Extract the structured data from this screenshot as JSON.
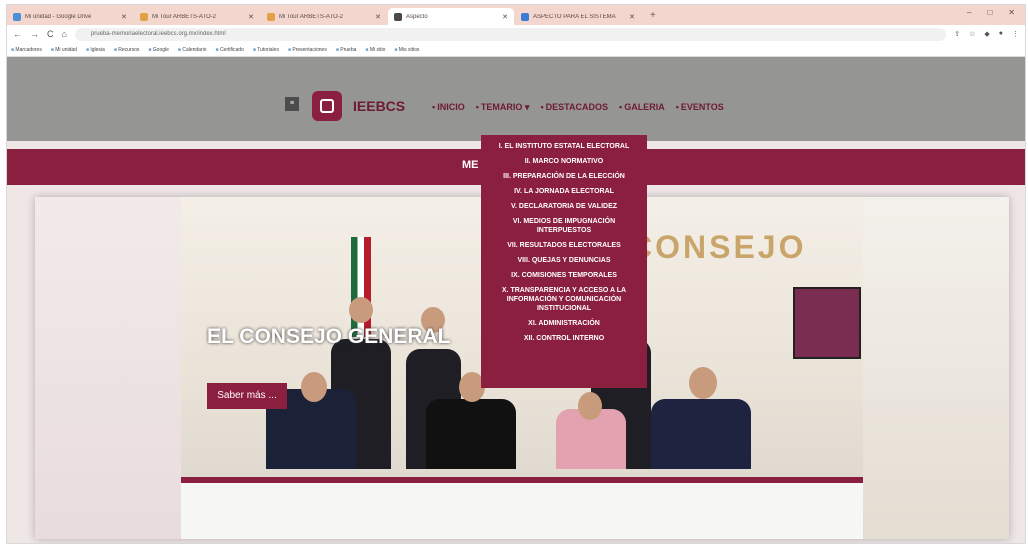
{
  "browser": {
    "tabs": [
      {
        "label": "Mi unidad - Google Drive",
        "color": "#4a90d9"
      },
      {
        "label": "Mi Tour ARBETS-ATO-2",
        "color": "#e1a144"
      },
      {
        "label": "Mi Tour ARBETS-ATO-2",
        "color": "#e1a144"
      },
      {
        "label": "Aspecto",
        "color": "#4a4a4a",
        "active": true
      },
      {
        "label": "ASPECTO PARA EL SISTEMA",
        "color": "#3d7bd6"
      }
    ],
    "new_tab": "+",
    "window_controls": [
      "–",
      "□",
      "✕"
    ],
    "url": "prueba-memoriaelectoral.ieebcs.org.mx/index.html",
    "bookmarks": [
      "Marcadores",
      "Mi unidad",
      "Iglesia",
      "Recursos",
      "Google",
      "Calendario",
      "Certificado",
      "Tutoriales",
      "Presentaciones",
      "Prueba",
      "Mi sitio",
      "Mis sitios"
    ]
  },
  "site": {
    "hamburger": "≡",
    "brand": "IEEBCS",
    "nav": [
      "INICIO",
      "TEMARIO ▾",
      "DESTACADOS",
      "GALERIA",
      "EVENTOS"
    ],
    "strip_title": "ME",
    "hero_title": "EL CONSEJO GENERAL",
    "hero_button": "Saber más ...",
    "wall_word": "CONSEJO",
    "dropdown": [
      "I. EL INSTITUTO ESTATAL ELECTORAL",
      "II. MARCO NORMATIVO",
      "III. PREPARACIÓN DE LA ELECCIÓN",
      "IV. LA JORNADA ELECTORAL",
      "V. DECLARATORIA DE VALIDEZ",
      "VI. MEDIOS DE IMPUGNACIÓN INTERPUESTOS",
      "VII. RESULTADOS ELECTORALES",
      "VIII. QUEJAS Y DENUNCIAS",
      "IX. COMISIONES TEMPORALES",
      "X. TRANSPARENCIA Y ACCESO A LA INFORMACIÓN Y COMUNICACIÓN INSTITUCIONAL",
      "XI. ADMINISTRACIÓN",
      "XII. CONTROL INTERNO"
    ]
  }
}
